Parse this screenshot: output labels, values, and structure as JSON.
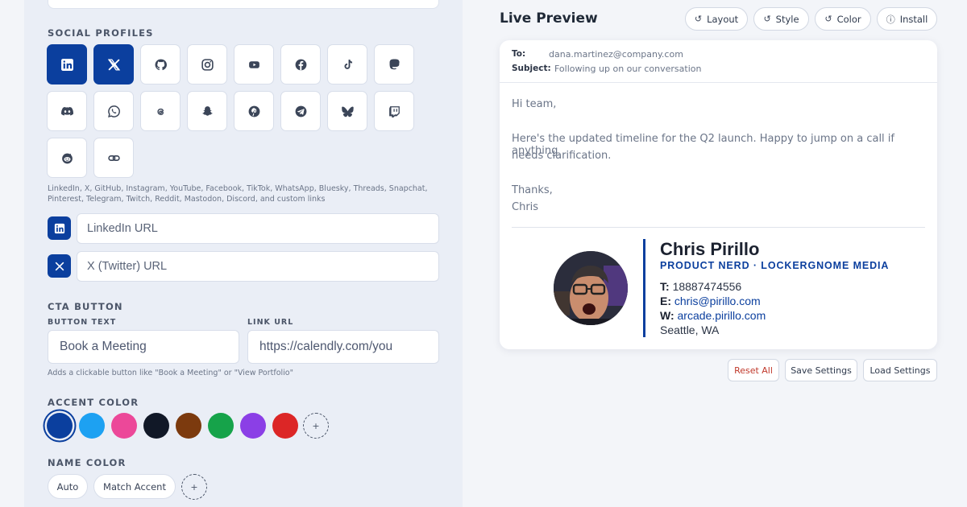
{
  "social": {
    "heading": "SOCIAL PROFILES",
    "supported_text": "LinkedIn, X, GitHub, Instagram, YouTube, Facebook, TikTok, WhatsApp, Bluesky, Threads, Snapchat, Pinterest, Telegram, Twitch, Reddit, Mastodon, Discord, and custom links",
    "icons": [
      {
        "name": "linkedin-icon",
        "active": true
      },
      {
        "name": "x-icon",
        "active": true
      },
      {
        "name": "github-icon",
        "active": false
      },
      {
        "name": "instagram-icon",
        "active": false
      },
      {
        "name": "youtube-icon",
        "active": false
      },
      {
        "name": "facebook-icon",
        "active": false
      },
      {
        "name": "tiktok-icon",
        "active": false
      },
      {
        "name": "mastodon-icon",
        "active": false
      },
      {
        "name": "discord-icon",
        "active": false
      },
      {
        "name": "whatsapp-icon",
        "active": false
      },
      {
        "name": "threads-icon",
        "active": false
      },
      {
        "name": "snapchat-icon",
        "active": false
      },
      {
        "name": "pinterest-icon",
        "active": false
      },
      {
        "name": "telegram-icon",
        "active": false
      },
      {
        "name": "bluesky-icon",
        "active": false
      },
      {
        "name": "twitch-icon",
        "active": false
      },
      {
        "name": "reddit-icon",
        "active": false
      },
      {
        "name": "link-icon",
        "active": false
      }
    ],
    "linkedin_placeholder": "LinkedIn URL",
    "x_placeholder": "X (Twitter) URL"
  },
  "cta": {
    "heading": "CTA BUTTON",
    "button_text_label": "BUTTON TEXT",
    "link_url_label": "LINK URL",
    "button_text_placeholder": "Book a Meeting",
    "link_url_placeholder": "https://calendly.com/you",
    "hint": "Adds a clickable button like \"Book a Meeting\" or \"View Portfolio\""
  },
  "accent": {
    "heading": "ACCENT COLOR",
    "swatches": [
      "#0b3f9e",
      "#1da1f2",
      "#ec4899",
      "#111827",
      "#7c3a0e",
      "#16a34a",
      "#8b3fe6",
      "#dc2626"
    ],
    "selected": "#0b3f9e",
    "add_label": "+"
  },
  "name_color": {
    "heading": "NAME COLOR",
    "auto_label": "Auto",
    "match_label": "Match Accent",
    "add_label": "+"
  },
  "preview": {
    "title": "Live Preview",
    "toolbar": [
      {
        "label": "Layout",
        "icon": "undo-icon"
      },
      {
        "label": "Style",
        "icon": "undo-icon"
      },
      {
        "label": "Color",
        "icon": "undo-icon"
      },
      {
        "label": "Install",
        "icon": "info-icon"
      }
    ],
    "email": {
      "to_label": "To:",
      "to_value": "dana.martinez@company.com",
      "subject_label": "Subject:",
      "subject_value": "Following up on our conversation",
      "body": [
        "Hi team,",
        "Here's the updated timeline for the Q2 launch. Happy to jump on a call if anything",
        "needs clarification.",
        "Thanks,",
        "Chris"
      ]
    },
    "signature": {
      "name": "Chris Pirillo",
      "title": "PRODUCT NERD · LOCKERGNOME MEDIA",
      "phone_label": "T:",
      "phone": "18887474556",
      "email_label": "E:",
      "email": "chris@pirillo.com",
      "web_label": "W:",
      "web": "arcade.pirillo.com",
      "location": "Seattle, WA"
    }
  },
  "actions": {
    "reset": "Reset All",
    "save": "Save Settings",
    "load": "Load Settings"
  }
}
